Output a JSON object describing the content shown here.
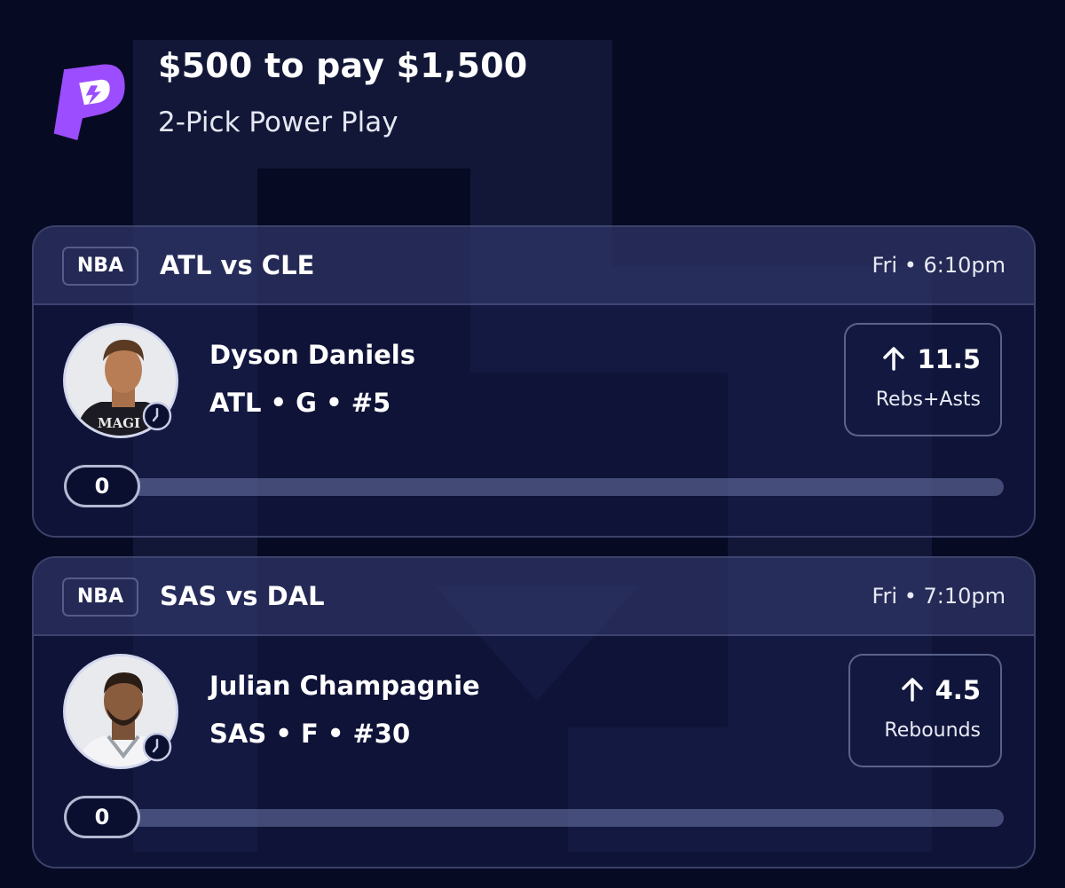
{
  "header": {
    "title": "$500 to pay $1,500",
    "subtitle": "2-Pick Power Play"
  },
  "colors": {
    "background": "#070a23",
    "logo_purple": "#9b4dff",
    "text_primary": "#ffffff"
  },
  "picks": [
    {
      "league": "NBA",
      "matchup": "ATL vs CLE",
      "time": "Fri • 6:10pm",
      "player_name": "Dyson Daniels",
      "player_info": "ATL • G • #5",
      "line": "11.5",
      "stat": "Rebs+Asts",
      "direction": "more",
      "progress_value": "0",
      "progress_fraction": 0
    },
    {
      "league": "NBA",
      "matchup": "SAS vs DAL",
      "time": "Fri • 7:10pm",
      "player_name": "Julian Champagnie",
      "player_info": "SAS • F • #30",
      "line": "4.5",
      "stat": "Rebounds",
      "direction": "more",
      "progress_value": "0",
      "progress_fraction": 0
    }
  ]
}
